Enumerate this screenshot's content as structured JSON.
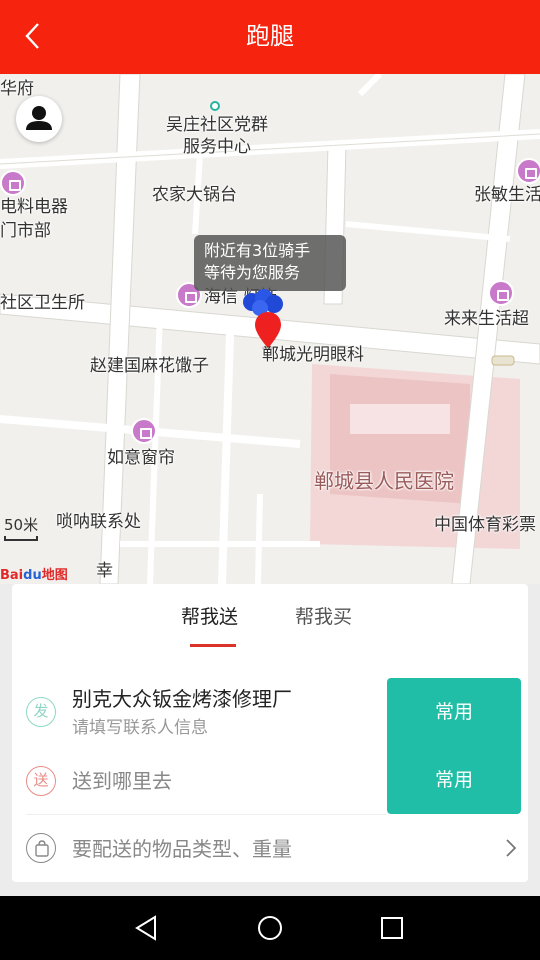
{
  "header": {
    "title": "跑腿",
    "back_icon": "chevron-left-icon"
  },
  "map": {
    "labels": {
      "wuzhuang": "吴庄社区党群服务中心",
      "nongjia": "农家大锅台",
      "zhangmin": "张敏生活",
      "dianliao": "电料电器",
      "menshibu": "门市部",
      "health": "社区卫生所",
      "haixin": "海信 灯饰",
      "laila": "来来生活超",
      "zhaojian": "赵建国麻花馓子",
      "eye": "郸城光明眼科",
      "ruyi": "如意窗帘",
      "hospital": "郸城县人民医院",
      "suona": "唢呐联系处",
      "lottery": "中国体育彩票",
      "top_left": "华府",
      "bottom_road": "幸"
    },
    "tooltip": {
      "line1": "附近有3位骑手",
      "line2": "等待为您服务"
    },
    "scale": "50米",
    "brand": {
      "name1": "Bai",
      "paw": "du",
      "name2": "地图"
    }
  },
  "panel": {
    "tabs": [
      {
        "label": "帮我送",
        "active": true
      },
      {
        "label": "帮我买",
        "active": false
      }
    ],
    "sender": {
      "badge": "发",
      "name": "别克大众钣金烤漆修理厂",
      "hint": "请填写联系人信息",
      "button": "常用"
    },
    "receiver": {
      "badge": "送",
      "placeholder": "送到哪里去",
      "button": "常用"
    },
    "goods": {
      "placeholder": "要配送的物品类型、重量",
      "icon": "bag-icon"
    }
  },
  "colors": {
    "brand_red": "#f6240f",
    "accent_teal": "#20bea6",
    "tab_underline": "#d9332a"
  }
}
